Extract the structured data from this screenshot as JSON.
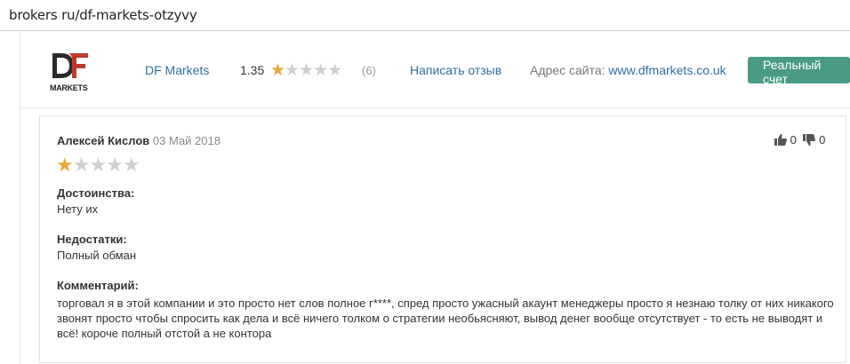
{
  "browser": {
    "url": "brokers ru/df-markets-otzyvy"
  },
  "header": {
    "logo_text": "MARKETS",
    "broker_name": "DF Markets",
    "rating_value": "1.35",
    "rating_stars": 1,
    "rating_max": 5,
    "rating_count": "(6)",
    "write_review": "Написать отзыв",
    "site_label": "Адрес сайта:",
    "site_url": "www.dfmarkets.co.uk",
    "real_account_button": "Реальный счет",
    "accent_color": "#4a9a85"
  },
  "review": {
    "author": "Алексей Кислов",
    "date": "03 Май 2018",
    "stars": 1,
    "likes": "0",
    "dislikes": "0",
    "pros_title": "Достоинства:",
    "pros_text": "Нету их",
    "cons_title": "Недостатки:",
    "cons_text": "Полный обман",
    "comment_title": "Комментарий:",
    "comment_text": "торговал я в этой компании и это просто нет слов полное г****, спред просто ужасный акаунт менеджеры просто я незнаю толку от них никакого звонят просто чтобы спросить как дела и всё ничего толком о стратегии необьясняют, вывод денег вообще отсутствует - то есть не выводят и всё! короче полный отстой а не контора"
  }
}
